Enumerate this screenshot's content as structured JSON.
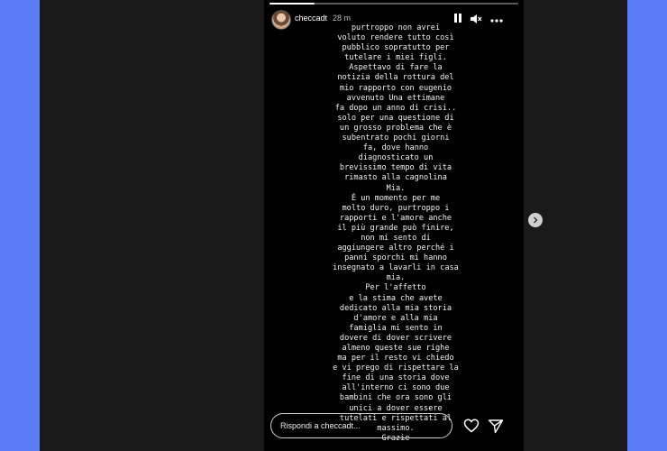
{
  "header": {
    "username": "checcadt",
    "time": "28 m"
  },
  "progress": {
    "fraction": 0.18
  },
  "story": {
    "text": "purtroppo non avrei\nvoluto rendere tutto così\npubblico sopratutto per\ntutelare i miei figli.\nAspettavo di fare la\nnotizia della rottura del\nmio rapporto con eugenio\navvenuto Una  ettimane\nfa dopo un anno di crisi..\nsolo per una questione di\nun grosso problema che è\nsubentrato pochi giorni\nfa, dove hanno\ndiagnosticato un\nbrevissimo tempo di vita\nrimasto alla cagnolina\nMia.\nÈ un momento per me\nmolto duro, purtroppo i\nrapporti  e l'amore anche\nil più grande può finire,\nnon mi sento di\naggiungere altro perché i\npanni sporchi mi hanno\ninsegnato a lavarli in casa\nmia.\nPer l'affetto\ne la stima che avete\ndedicato alla mia storia\nd'amore e alla mia\nfamiglia mi sento in\ndovere di dover scrivere\nalmeno queste sue righe\nma per il resto vi chiedo\ne vi prego di rispettare la\nfine di una storia dove\nall'interno ci sono due\nbambini che ora sono gli\nunici a dover essere\ntutelati e rispettati al\nmassimo.\nGrazie"
  },
  "reply": {
    "placeholder": "Rispondi a checcadt..."
  },
  "icons": {
    "pause": "pause-icon",
    "mute": "speaker-muted-icon",
    "more": "more-dots-icon",
    "like": "heart-icon",
    "send": "send-icon",
    "next": "chevron-right-icon"
  },
  "colors": {
    "page_background": "#5b7cf6",
    "viewer_background": "#1a1a1a",
    "story_background": "#000000"
  }
}
